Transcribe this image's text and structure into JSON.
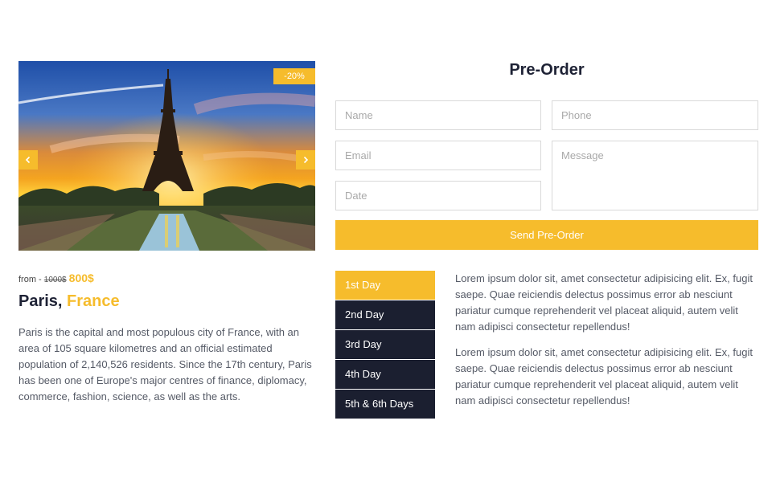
{
  "slider": {
    "discount": "-20%",
    "image_subject": "Eiffel Tower at sunset",
    "prev_icon": "chevron-left-icon",
    "next_icon": "chevron-right-icon"
  },
  "tour": {
    "price_prefix": "from -",
    "old_price": "1000$",
    "new_price": "800$",
    "city": "Paris,",
    "country": "France",
    "description": "Paris is the capital and most populous city of France, with an area of 105 square kilometres and an official estimated population of 2,140,526 residents. Since the 17th century, Paris has been one of Europe's major centres of finance, diplomacy, commerce, fashion, science, as well as the arts."
  },
  "form": {
    "title": "Pre-Order",
    "name_placeholder": "Name",
    "phone_placeholder": "Phone",
    "email_placeholder": "Email",
    "message_placeholder": "Message",
    "date_placeholder": "Date",
    "submit_label": "Send Pre-Order"
  },
  "days": {
    "tabs": [
      "1st Day",
      "2nd Day",
      "3rd Day",
      "4th Day",
      "5th & 6th Days"
    ],
    "active_index": 0,
    "paragraphs": [
      "Lorem ipsum dolor sit, amet consectetur adipisicing elit. Ex, fugit saepe. Quae reiciendis delectus possimus error ab nesciunt pariatur cumque reprehenderit vel placeat aliquid, autem velit nam adipisci consectetur repellendus!",
      "Lorem ipsum dolor sit, amet consectetur adipisicing elit. Ex, fugit saepe. Quae reiciendis delectus possimus error ab nesciunt pariatur cumque reprehenderit vel placeat aliquid, autem velit nam adipisci consectetur repellendus!"
    ]
  },
  "colors": {
    "accent": "#f6bc2c",
    "dark": "#1b1f30",
    "text": "#555a66",
    "border": "#d9d9d9"
  }
}
